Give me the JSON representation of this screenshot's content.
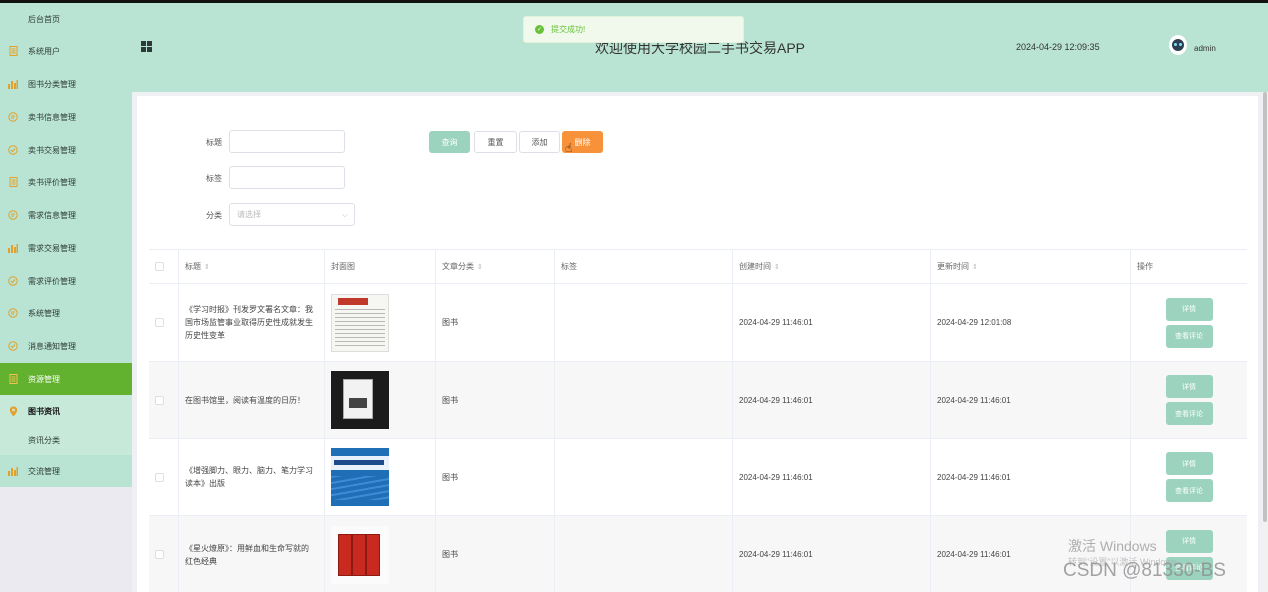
{
  "sidebar": {
    "items": [
      {
        "label": "后台首页",
        "icon": "none"
      },
      {
        "label": "系统用户",
        "icon": "doc-icon"
      },
      {
        "label": "图书分类管理",
        "icon": "bar-chart-icon"
      },
      {
        "label": "卖书信息管理",
        "icon": "message-icon"
      },
      {
        "label": "卖书交易管理",
        "icon": "check-circle-icon"
      },
      {
        "label": "卖书评价管理",
        "icon": "doc-icon"
      },
      {
        "label": "需求信息管理",
        "icon": "message-icon"
      },
      {
        "label": "需求交易管理",
        "icon": "bar-chart-icon"
      },
      {
        "label": "需求评价管理",
        "icon": "check-circle-icon"
      },
      {
        "label": "系统管理",
        "icon": "message-icon"
      },
      {
        "label": "消息通知管理",
        "icon": "check-circle-icon"
      },
      {
        "label": "资源管理",
        "icon": "doc-icon"
      },
      {
        "label": "图书资讯",
        "icon": "location-icon"
      },
      {
        "label": "资讯分类",
        "icon": "none"
      },
      {
        "label": "交流管理",
        "icon": "bar-chart-icon"
      }
    ]
  },
  "header": {
    "title": "欢迎使用大学校园二手书交易APP",
    "datetime": "2024-04-29 12:09:35",
    "username": "admin"
  },
  "toast": {
    "message": "提交成功!"
  },
  "filters": {
    "title_label": "标题",
    "tag_label": "标签",
    "category_label": "分类",
    "category_placeholder": "请选择"
  },
  "buttons": {
    "search": "查询",
    "reset": "重置",
    "add": "添加",
    "delete": "删除"
  },
  "table": {
    "headers": {
      "title": "标题",
      "cover": "封面图",
      "category": "文章分类",
      "tag": "标签",
      "created": "创建时间",
      "updated": "更新时间",
      "actions": "操作"
    },
    "rows": [
      {
        "title": "《学习时报》刊发罗文署名文章：我国市场监管事业取得历史性成就发生历史性变革",
        "category": "图书",
        "tag": "",
        "created": "2024-04-29 11:46:01",
        "updated": "2024-04-29 12:01:08",
        "action1": "详情",
        "action2": "查看评论"
      },
      {
        "title": "在图书馆里，阅读有温度的日历！",
        "category": "图书",
        "tag": "",
        "created": "2024-04-29 11:46:01",
        "updated": "2024-04-29 11:46:01",
        "action1": "详情",
        "action2": "查看评论"
      },
      {
        "title": "《增强脚力、眼力、脑力、笔力学习读本》出版",
        "category": "图书",
        "tag": "",
        "created": "2024-04-29 11:46:01",
        "updated": "2024-04-29 11:46:01",
        "action1": "详情",
        "action2": "查看评论"
      },
      {
        "title": "《星火燎原》：用鲜血和生命写就的红色经典",
        "category": "图书",
        "tag": "",
        "created": "2024-04-29 11:46:01",
        "updated": "2024-04-29 11:46:01",
        "action1": "详情",
        "action2": "查看评论"
      }
    ]
  },
  "watermarks": {
    "windows": "激活 Windows",
    "windows_sub": "转到\"设置\"以激活 Windows。",
    "csdn": "CSDN @81330-BS"
  }
}
